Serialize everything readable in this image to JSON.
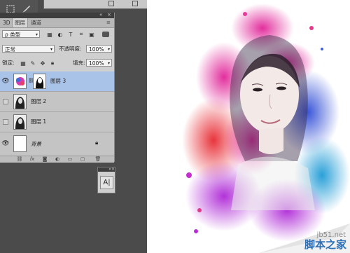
{
  "panel": {
    "tabs": [
      {
        "label": "3D"
      },
      {
        "label": "图层"
      },
      {
        "label": "通道"
      }
    ],
    "filter_select": "ρ 类型",
    "blend_mode": "正常",
    "opacity_label": "不透明度:",
    "opacity_value": "100%",
    "lock_label": "锁定:",
    "fill_label": "填充:",
    "fill_value": "100%",
    "layers": [
      {
        "name": "图层 3",
        "selected": true,
        "visible": true
      },
      {
        "name": "图层 2",
        "selected": false,
        "visible": false
      },
      {
        "name": "图层 1",
        "selected": false,
        "visible": false
      },
      {
        "name": "背景",
        "selected": false,
        "visible": true,
        "locked": true
      }
    ],
    "bottom_icons": [
      "link-icon",
      "fx-icon",
      "mask-icon",
      "adjustment-icon",
      "folder-icon",
      "new-layer-icon",
      "trash-icon"
    ],
    "bottom_fx": "fx"
  },
  "char_panel": {
    "button": "A|"
  },
  "watermark": {
    "site": "jb51.net",
    "name": "脚本之家"
  },
  "colors": {
    "selection": "#a9c2e8",
    "panel_bg": "#cfcfcf",
    "workspace": "#4b4b4b",
    "watermark_blue": "#2a6fb8"
  }
}
